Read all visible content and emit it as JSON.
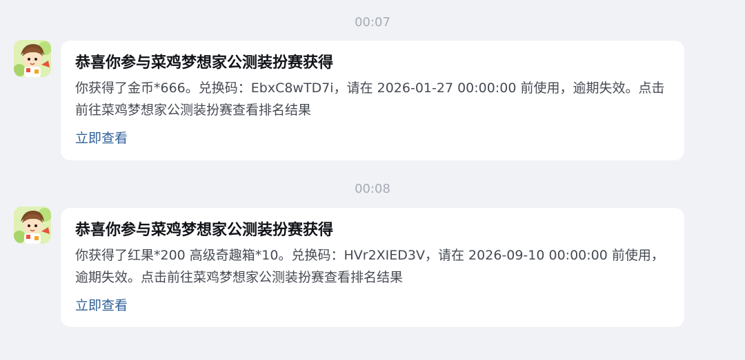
{
  "messages": [
    {
      "time": "00:07",
      "title": "恭喜你参与菜鸡梦想家公测装扮赛获得",
      "body": "你获得了金币*666。兑换码：EbxC8wTD7i，请在 2026-01-27 00:00:00 前使用，逾期失效。点击前往菜鸡梦想家公测装扮赛查看排名结果",
      "link": "立即查看"
    },
    {
      "time": "00:08",
      "title": "恭喜你参与菜鸡梦想家公测装扮赛获得",
      "body": "你获得了红果*200 高级奇趣箱*10。兑换码：HVr2XIED3V，请在 2026-09-10 00:00:00 前使用，逾期失效。点击前往菜鸡梦想家公测装扮赛查看排名结果",
      "link": "立即查看"
    }
  ],
  "colors": {
    "background": "#f1f2f6",
    "card": "#ffffff",
    "link": "#2e5f98",
    "timestamp": "#a6abb4"
  },
  "icons": {
    "avatar": "game-character-avatar-icon"
  }
}
